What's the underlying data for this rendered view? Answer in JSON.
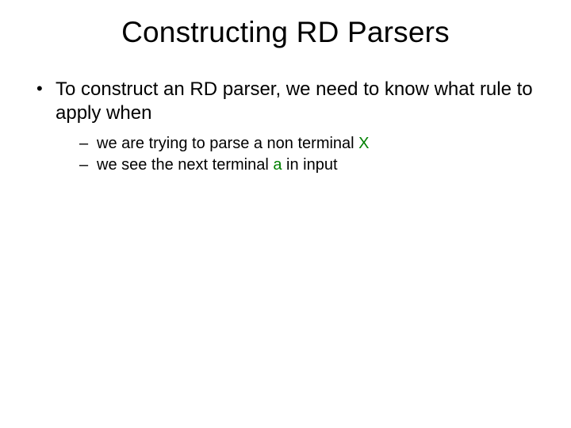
{
  "title": "Constructing RD Parsers",
  "bullet1": "To construct an RD parser, we need to know what rule to apply when",
  "sub1_pre": "we are trying to parse a non terminal ",
  "sub1_hl": "X",
  "sub2_pre": "we see the next terminal ",
  "sub2_hl": "a",
  "sub2_post": " in input"
}
